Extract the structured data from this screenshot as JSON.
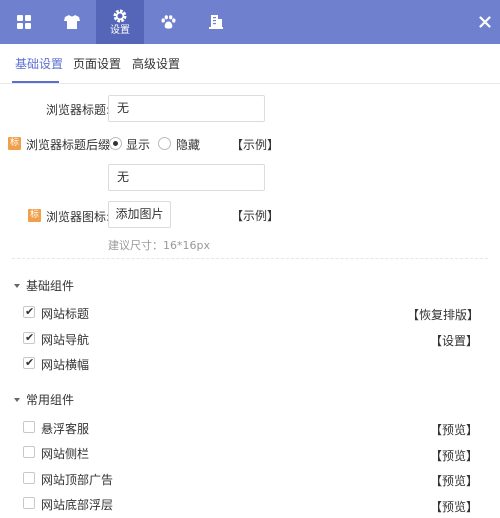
{
  "topbar": {
    "items": [
      {
        "icon": "grid-icon",
        "label": ""
      },
      {
        "icon": "shirt-icon",
        "label": ""
      },
      {
        "icon": "gear-icon",
        "label": "设置"
      },
      {
        "icon": "paw-icon",
        "label": ""
      },
      {
        "icon": "building-icon",
        "label": ""
      }
    ],
    "active_index": 2,
    "close_icon": "close-icon",
    "accent_color": "#6f80cf"
  },
  "tabs": {
    "items": [
      "基础设置",
      "页面设置",
      "高级设置"
    ],
    "active": "基础设置",
    "active_color": "#5b6fd0"
  },
  "basic": {
    "browser_title": {
      "label": "浏览器标题:",
      "value": "无"
    },
    "title_suffix": {
      "tag": "标",
      "label": "浏览器标题后缀:",
      "options": [
        "显示",
        "隐藏"
      ],
      "selected": "显示",
      "example_link": "【示例】",
      "value": "无"
    },
    "browser_icon": {
      "tag": "标",
      "label": "浏览器图标:",
      "button": "添加图片",
      "example_link": "【示例】",
      "hint": "建议尺寸：16*16px"
    },
    "tag_color": "#f0a04b"
  },
  "sections": [
    {
      "title": "基础组件",
      "items": [
        {
          "label": "网站标题",
          "checked": true,
          "action": "【恢复排版】"
        },
        {
          "label": "网站导航",
          "checked": true,
          "action": "【设置】"
        },
        {
          "label": "网站横幅",
          "checked": true,
          "action": ""
        }
      ]
    },
    {
      "title": "常用组件",
      "items": [
        {
          "label": "悬浮客服",
          "checked": false,
          "action": "【预览】"
        },
        {
          "label": "网站侧栏",
          "checked": false,
          "action": "【预览】"
        },
        {
          "label": "网站顶部广告",
          "checked": false,
          "action": "【预览】"
        },
        {
          "label": "网站底部浮层",
          "checked": false,
          "action": "【预览】"
        }
      ]
    }
  ]
}
